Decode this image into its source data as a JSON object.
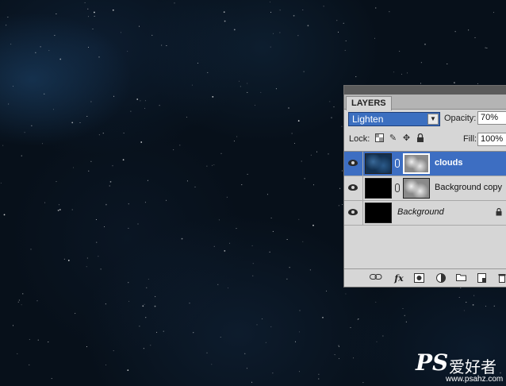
{
  "panel": {
    "tab_label": "LAYERS",
    "blend_mode": "Lighten",
    "opacity_label": "Opacity:",
    "opacity_value": "70%",
    "lock_label": "Lock:",
    "fill_label": "Fill:",
    "fill_value": "100%"
  },
  "layers": [
    {
      "name": "clouds",
      "selected": true,
      "visible": true,
      "has_mask": true
    },
    {
      "name": "Background copy",
      "selected": false,
      "visible": true,
      "has_mask": true
    },
    {
      "name": "Background",
      "selected": false,
      "visible": true,
      "has_mask": false,
      "locked": true
    }
  ],
  "watermark": {
    "ps": "PS",
    "cn": "爱好者",
    "url": "www.psahz.com"
  },
  "colors": {
    "selection": "#3d6ec2",
    "panel_bg": "#d6d6d6",
    "canvas_bg": "#07101a"
  }
}
